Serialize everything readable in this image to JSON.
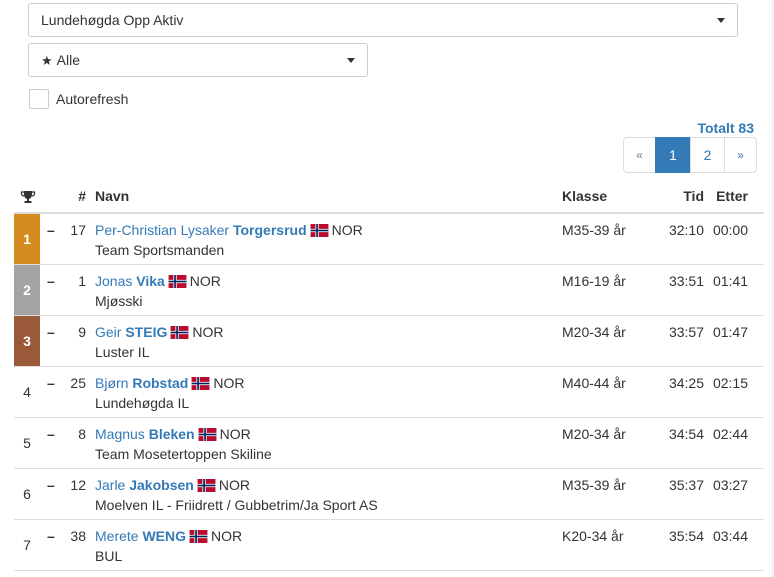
{
  "filters": {
    "event_selected": "Lundehøgda Opp Aktiv",
    "class_selected": "Alle",
    "autorefresh_label": "Autorefresh"
  },
  "total_label": "Totalt 83",
  "pagination": {
    "prev": "«",
    "pages": [
      "1",
      "2"
    ],
    "next": "»",
    "active_page": "1"
  },
  "table": {
    "headers": {
      "rank": "",
      "bib": "#",
      "name": "Navn",
      "class": "Klasse",
      "time": "Tid",
      "behind": "Etter"
    },
    "rows": [
      {
        "place": "1",
        "bib": "17",
        "first": "Per-Christian Lysaker ",
        "last": "Torgersrud",
        "nat": "NOR",
        "club": "Team Sportsmanden",
        "class": "M35-39 år",
        "time": "32:10",
        "behind": "00:00"
      },
      {
        "place": "2",
        "bib": "1",
        "first": "Jonas ",
        "last": "Vika",
        "nat": "NOR",
        "club": "Mjøsski",
        "class": "M16-19 år",
        "time": "33:51",
        "behind": "01:41"
      },
      {
        "place": "3",
        "bib": "9",
        "first": "Geir ",
        "last": "STEIG",
        "nat": "NOR",
        "club": "Luster IL",
        "class": "M20-34 år",
        "time": "33:57",
        "behind": "01:47"
      },
      {
        "place": "4",
        "bib": "25",
        "first": "Bjørn ",
        "last": "Robstad",
        "nat": "NOR",
        "club": "Lundehøgda IL",
        "class": "M40-44 år",
        "time": "34:25",
        "behind": "02:15"
      },
      {
        "place": "5",
        "bib": "8",
        "first": "Magnus ",
        "last": "Bleken",
        "nat": "NOR",
        "club": "Team Mosetertoppen Skiline",
        "class": "M20-34 år",
        "time": "34:54",
        "behind": "02:44"
      },
      {
        "place": "6",
        "bib": "12",
        "first": "Jarle ",
        "last": "Jakobsen",
        "nat": "NOR",
        "club": "Moelven IL - Friidrett / Gubbetrim/Ja Sport AS",
        "class": "M35-39 år",
        "time": "35:37",
        "behind": "03:27"
      },
      {
        "place": "7",
        "bib": "38",
        "first": "Merete ",
        "last": "WENG",
        "nat": "NOR",
        "club": "BUL",
        "class": "K20-34 år",
        "time": "35:54",
        "behind": "03:44"
      }
    ]
  },
  "colors": {
    "link": "#337ab7",
    "gold": "#d58b1e",
    "silver": "#a3a3a3",
    "bronze": "#9a5a3a"
  },
  "icons": {
    "rank_header": "trophy-icon",
    "class_select": "star-icon",
    "flag": "norway-flag-icon"
  }
}
